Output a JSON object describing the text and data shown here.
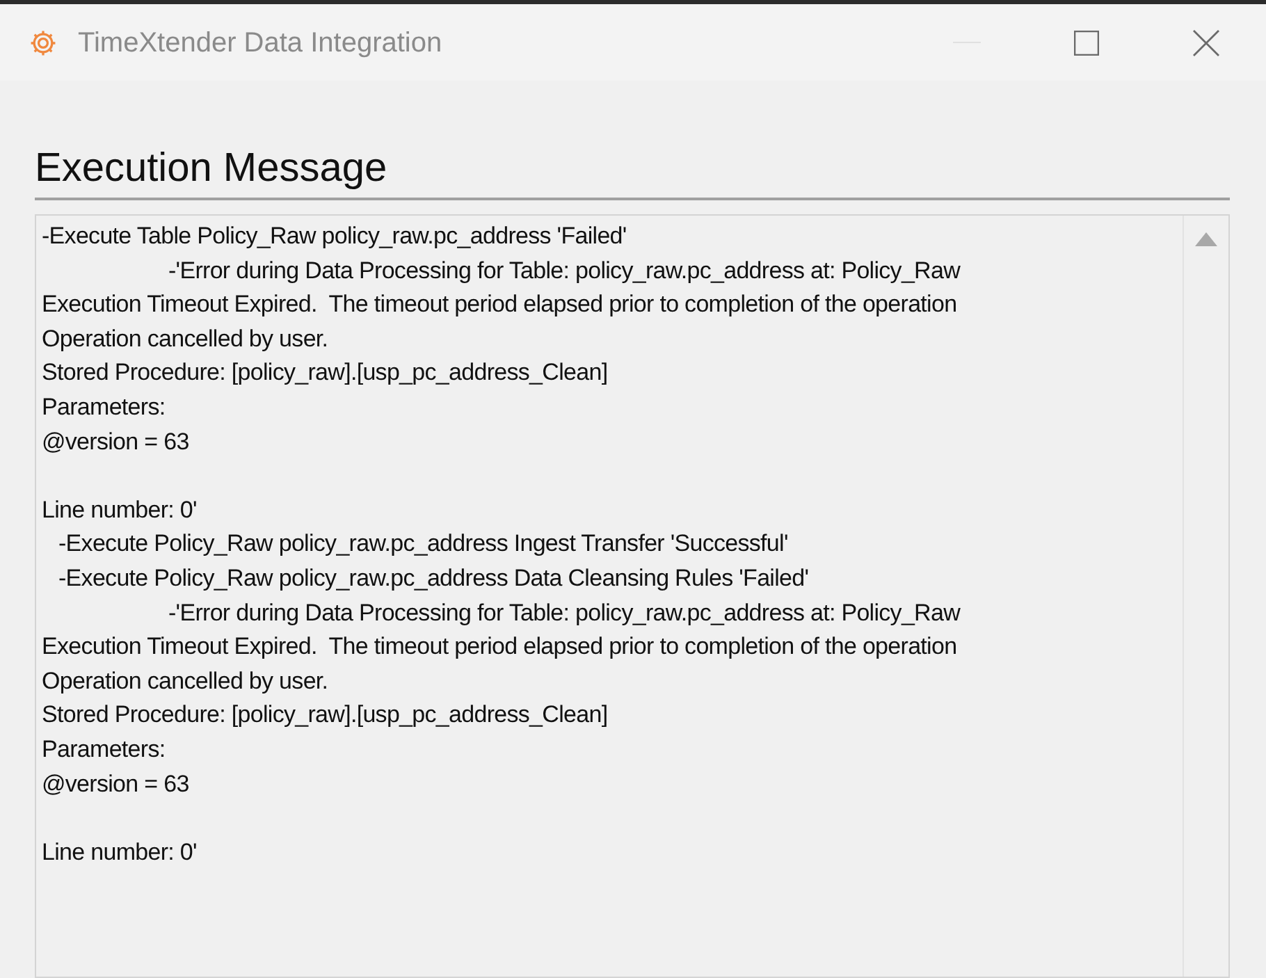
{
  "window": {
    "title": "TimeXtender Data Integration",
    "minimize_disabled": true
  },
  "heading": "Execution Message",
  "message_lines": [
    {
      "kind": "plain",
      "text": "-Execute Table Policy_Raw policy_raw.pc_address 'Failed'"
    },
    {
      "kind": "error",
      "text": "-'Error during Data Processing for Table: policy_raw.pc_address at: Policy_Raw"
    },
    {
      "kind": "plain",
      "text": "Execution Timeout Expired.  The timeout period elapsed prior to completion of the operation"
    },
    {
      "kind": "plain",
      "text": "Operation cancelled by user."
    },
    {
      "kind": "plain",
      "text": "Stored Procedure: [policy_raw].[usp_pc_address_Clean]"
    },
    {
      "kind": "plain",
      "text": "Parameters:"
    },
    {
      "kind": "plain",
      "text": "@version = 63"
    },
    {
      "kind": "blank"
    },
    {
      "kind": "plain",
      "text": "Line number: 0'"
    },
    {
      "kind": "step",
      "text": "-Execute Policy_Raw policy_raw.pc_address Ingest Transfer 'Successful'"
    },
    {
      "kind": "step",
      "text": "-Execute Policy_Raw policy_raw.pc_address Data Cleansing Rules 'Failed'"
    },
    {
      "kind": "error",
      "text": "-'Error during Data Processing for Table: policy_raw.pc_address at: Policy_Raw"
    },
    {
      "kind": "plain",
      "text": "Execution Timeout Expired.  The timeout period elapsed prior to completion of the operation"
    },
    {
      "kind": "plain",
      "text": "Operation cancelled by user."
    },
    {
      "kind": "plain",
      "text": "Stored Procedure: [policy_raw].[usp_pc_address_Clean]"
    },
    {
      "kind": "plain",
      "text": "Parameters:"
    },
    {
      "kind": "plain",
      "text": "@version = 63"
    },
    {
      "kind": "blank"
    },
    {
      "kind": "plain",
      "text": "Line number: 0'"
    }
  ]
}
